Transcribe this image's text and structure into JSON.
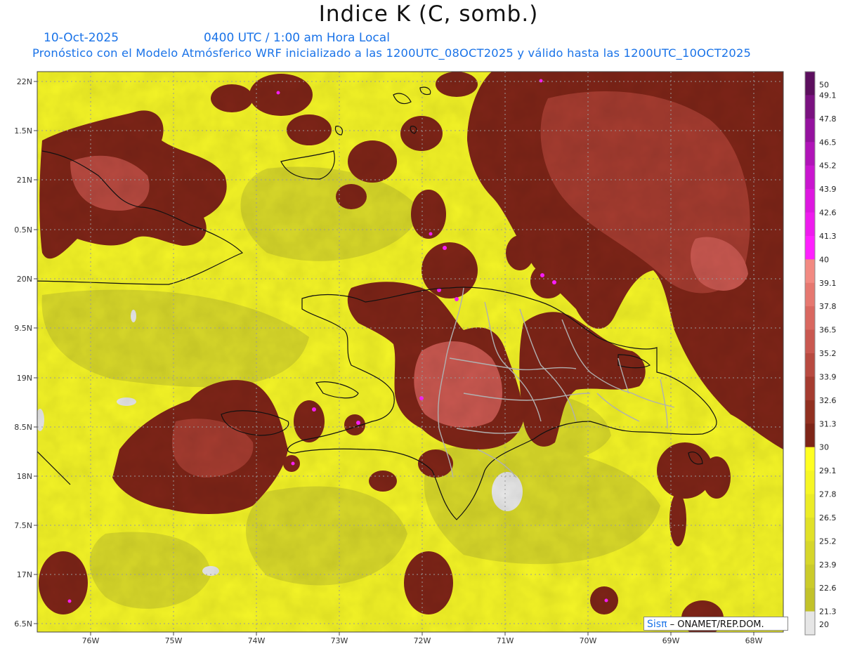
{
  "title": "Indice K (C, somb.)",
  "date": "10-Oct-2025",
  "valid_time": "0400 UTC / 1:00 am Hora Local",
  "model_line": "Pronóstico con el Modelo Atmósferico WRF inicializado a las 1200UTC_08OCT2025 y válido hasta las  1200UTC_10OCT2025",
  "credit_brand": "Sisπ",
  "credit_text": "– ONAMET/REP.DOM.",
  "lat_labels": [
    "22N",
    "1.5N",
    "21N",
    "0.5N",
    "20N",
    "9.5N",
    "19N",
    "8.5N",
    "18N",
    "7.5N",
    "17N",
    "6.5N"
  ],
  "lon_labels": [
    "76W",
    "75W",
    "74W",
    "73W",
    "72W",
    "71W",
    "70W",
    "69W",
    "68W"
  ],
  "legend": {
    "labels": [
      "50",
      "49.1",
      "47.8",
      "46.5",
      "45.2",
      "43.9",
      "42.6",
      "41.3",
      "40",
      "39.1",
      "37.8",
      "36.5",
      "35.2",
      "33.9",
      "32.6",
      "31.3",
      "30",
      "29.1",
      "27.8",
      "26.5",
      "25.2",
      "23.9",
      "22.6",
      "21.3",
      "20"
    ],
    "colors": [
      "#5c0f5e",
      "#7a1280",
      "#94129e",
      "#b014b8",
      "#c916cf",
      "#dd18e0",
      "#ee1cee",
      "#ff20ff",
      "#f28a82",
      "#e67870",
      "#d96860",
      "#c95850",
      "#b84a40",
      "#a53c30",
      "#913020",
      "#7e2518",
      "#ffff22",
      "#f6f624",
      "#ecec26",
      "#e1e128",
      "#d6d62a",
      "#cbcb2a",
      "#c2c22a",
      "#e6e6e6"
    ]
  },
  "colors": {
    "land_outline": "#111111",
    "province_border": "#b0b0b0",
    "grid": "#9a9a9a",
    "title_blue": "#1a73e8"
  }
}
